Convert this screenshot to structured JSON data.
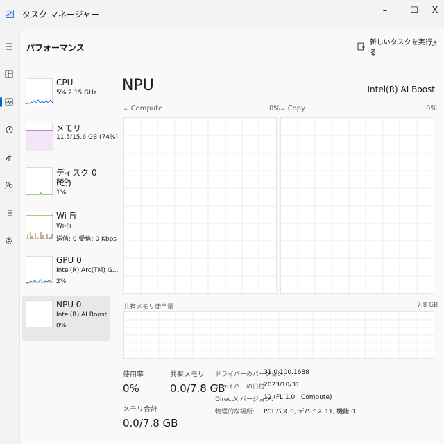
{
  "window": {
    "title": "タスク マネージャー",
    "minimize": "–",
    "maximize": "☐",
    "close": "X"
  },
  "rail": {
    "items": [
      "hamburger-icon",
      "processes-icon",
      "performance-icon",
      "history-icon",
      "startup-icon",
      "users-icon",
      "details-icon",
      "services-icon"
    ],
    "active": "performance-icon"
  },
  "toolbar": {
    "title": "パフォーマンス",
    "run_task_label": "新しいタスクを実行する",
    "more": "···"
  },
  "resources": [
    {
      "name": "CPU",
      "sub1": "5% 2.15 GHz",
      "sub2": "",
      "color": "#1170cf"
    },
    {
      "name": "メモリ",
      "sub1": "11.5/15.6 GB (74%)",
      "sub2": "",
      "color": "#8b1fa3"
    },
    {
      "name": "ディスク 0 (C:)",
      "sub1": "SSD",
      "sub2": "1%",
      "color": "#4b9a2e"
    },
    {
      "name": "Wi-Fi",
      "sub1": "Wi-Fi",
      "sub2": "送信: 0 受信: 0 Kbps",
      "color": "#a7621e"
    },
    {
      "name": "GPU 0",
      "sub1": "Intel(R) Arc(TM) G...",
      "sub2": "2%",
      "color": "#1170cf"
    },
    {
      "name": "NPU 0",
      "sub1": "Intel(R) AI Boost",
      "sub2": "0%",
      "color": "#1170cf"
    }
  ],
  "detail": {
    "title": "NPU",
    "device": "Intel(R) AI Boost",
    "graphs": [
      {
        "name": "Compute",
        "max": "0%"
      },
      {
        "name": "Copy",
        "max": "0%"
      }
    ],
    "shared_memory": {
      "label": "共有メモリ使用量",
      "max": "7.8 GB"
    },
    "stats": {
      "usage_label": "使用率",
      "usage_value": "0%",
      "shared_label": "共有メモリ",
      "shared_value": "0.0/7.8 GB",
      "memory_total_label": "メモリ合計",
      "memory_total_value": "0.0/7.8 GB"
    },
    "props": [
      {
        "key": "ドライバーのバージョン:",
        "value": "31.0.100.1688"
      },
      {
        "key": "ドライバーの日付:",
        "value": "2023/10/31"
      },
      {
        "key": "DirectX バージョン:",
        "value": "12 (FL 1.0 : Compute)"
      },
      {
        "key": "物理的な場所:",
        "value": "PCI バス 0, デバイス 11, 機能 0"
      }
    ]
  }
}
